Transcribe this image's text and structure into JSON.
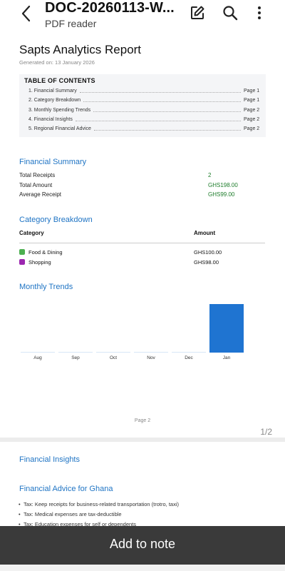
{
  "app": {
    "title": "DOC-20260113-W...",
    "subtitle": "PDF reader"
  },
  "report": {
    "title": "Sapts Analytics Report",
    "generated": "Generated on: 13 January 2026",
    "toc": {
      "title": "TABLE OF CONTENTS",
      "items": [
        {
          "label": "1. Financial Summary",
          "page": "Page 1"
        },
        {
          "label": "2. Category Breakdown",
          "page": "Page 1"
        },
        {
          "label": "3. Monthly Spending Trends",
          "page": "Page 2"
        },
        {
          "label": "4. Financial Insights",
          "page": "Page 2"
        },
        {
          "label": "5. Regional Financial Advice",
          "page": "Page 2"
        }
      ]
    },
    "summary": {
      "heading": "Financial Summary",
      "rows": [
        {
          "label": "Total Receipts",
          "value": "2"
        },
        {
          "label": "Total Amount",
          "value": "GHS198.00"
        },
        {
          "label": "Average Receipt",
          "value": "GHS99.00"
        }
      ]
    },
    "category": {
      "heading": "Category Breakdown",
      "col_category": "Category",
      "col_amount": "Amount",
      "rows": [
        {
          "name": "Food & Dining",
          "amount": "GHS100.00",
          "color": "#4caf50"
        },
        {
          "name": "Shopping",
          "amount": "GHS98.00",
          "color": "#9c27b0"
        }
      ]
    },
    "trends_heading": "Monthly Trends",
    "page_label": "Page 2",
    "page2": {
      "insights_heading": "Financial Insights",
      "advice_heading": "Financial Advice for Ghana",
      "advice": [
        "Tax: Keep receipts for business-related transportation (trotro, taxi)",
        "Tax: Medical expenses are tax-deductible",
        "Tax: Education expenses for self or dependents"
      ]
    }
  },
  "viewer": {
    "page_count": "1/2",
    "add_note": "Add to note"
  },
  "chart_data": {
    "type": "bar",
    "categories": [
      "Aug",
      "Sep",
      "Oct",
      "Nov",
      "Dec",
      "Jan"
    ],
    "values": [
      0,
      0,
      0,
      0,
      0,
      198
    ],
    "color": "#1f74d1",
    "ylim": [
      0,
      198
    ]
  }
}
